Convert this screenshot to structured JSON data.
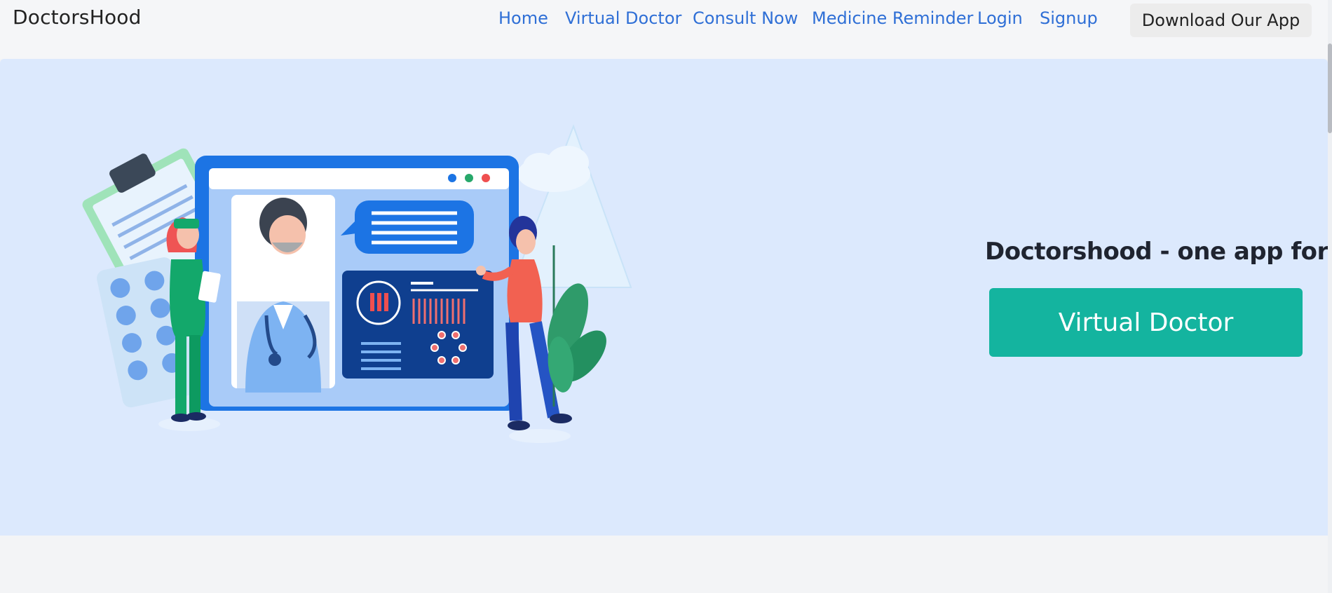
{
  "navbar": {
    "brand": "DoctorsHood",
    "links": [
      {
        "label": "Home"
      },
      {
        "label": "Virtual Doctor"
      },
      {
        "label": "Consult Now"
      },
      {
        "label": "Medicine Reminder"
      },
      {
        "label": "Login"
      },
      {
        "label": "Signup"
      }
    ],
    "download_label": "Download Our App"
  },
  "hero": {
    "tagline": "Doctorshood - one app for all",
    "cta_label": "Virtual Doctor",
    "illustration": "telemedicine-illustration"
  },
  "colors": {
    "hero_bg": "#dce9fd",
    "cta_bg": "#14b49f",
    "link": "#2f6fd6"
  }
}
